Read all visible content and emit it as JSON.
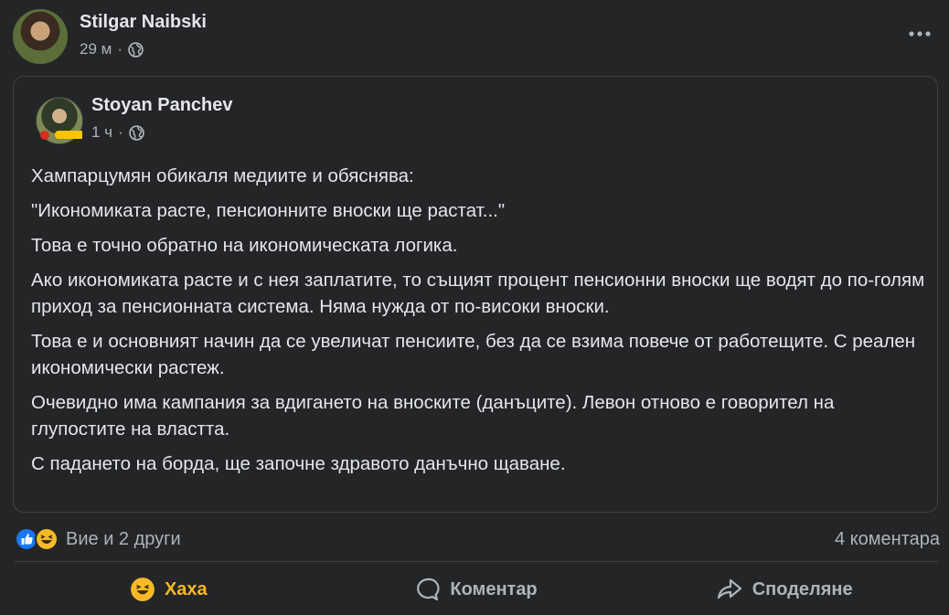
{
  "post": {
    "author": "Stilgar Naibski",
    "time": "29 м",
    "more_icon": "more-horizontal-icon",
    "shared": {
      "author": "Stoyan Panchev",
      "time": "1 ч",
      "paragraphs": [
        "Хампарцумян обикаля медиите и обяснява:",
        "\"Икономиката расте, пенсионните вноски ще растат...\"",
        "Това е точно обратно на икономическата логика.",
        "Ако икономиката расте и с нея заплатите, то същият процент пенсионни вноски ще водят до по-голям приход за пенсионната система. Няма нужда от по-високи вноски.",
        "Това е и основният начин да се увеличат пенсиите, без да се взима повече от работещите. С реален икономически растеж.",
        "Очевидно има кампания за вдигането на вноските (данъците). Левон отново е говорител на глупостите на властта.",
        "С падането на борда, ще започне здравото данъчно щаване."
      ]
    }
  },
  "reactions": {
    "icons": [
      "like-icon",
      "haha-icon"
    ],
    "summary": "Вие и 2 други",
    "comments": "4 коментара"
  },
  "actions": {
    "haha": "Хаха",
    "comment": "Коментар",
    "share": "Споделяне"
  },
  "colors": {
    "background": "#242526",
    "text": "#e4e6eb",
    "secondary": "#b0b3b8",
    "haha": "#f7b928",
    "like": "#1877f2"
  }
}
